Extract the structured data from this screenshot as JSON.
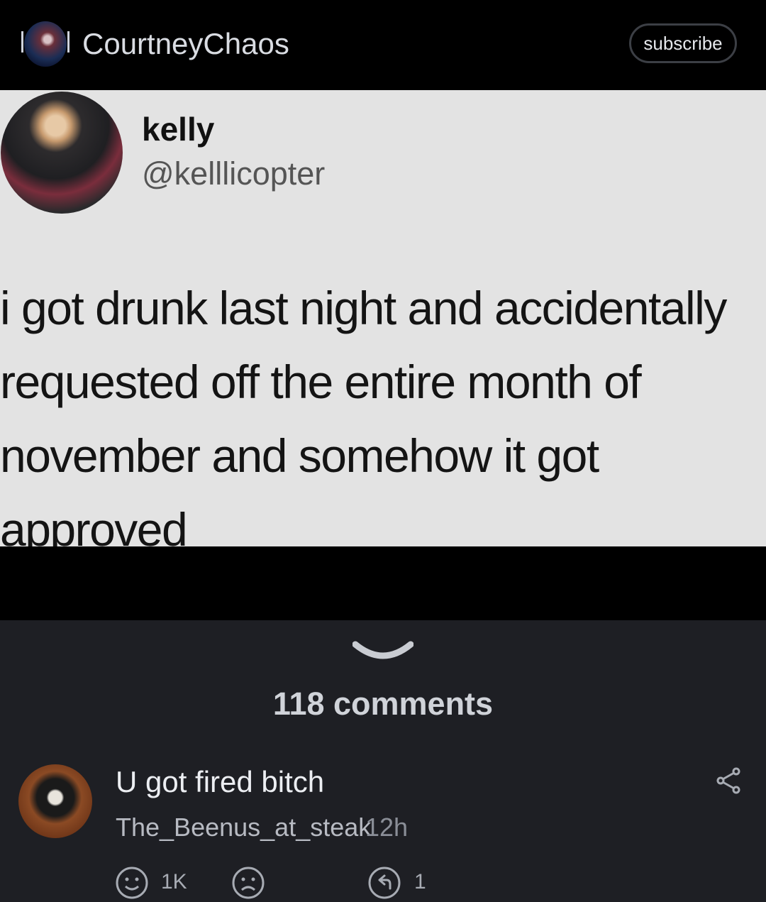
{
  "header": {
    "channel_name": "CourtneyChaos",
    "subscribe_label": "subscribe"
  },
  "tweet": {
    "name": "kelly",
    "handle": "@kelllicopter",
    "lines": [
      "i got drunk last night and accidentally",
      "requested off the entire month of",
      "november and somehow it got",
      "approved"
    ]
  },
  "comments": {
    "count_label": "118 comments",
    "items": [
      {
        "text": "U got fired bitch",
        "user": "The_Beenus_at_steak",
        "time": "12h",
        "likes": "1K",
        "replies": "1",
        "icons": [
          "smile-icon",
          "frown-icon",
          "reply-icon",
          "share-icon"
        ]
      }
    ]
  },
  "colors": {
    "background": "#000000",
    "tweet_bg": "#e3e3e3",
    "comments_bg": "#1e1f24"
  }
}
